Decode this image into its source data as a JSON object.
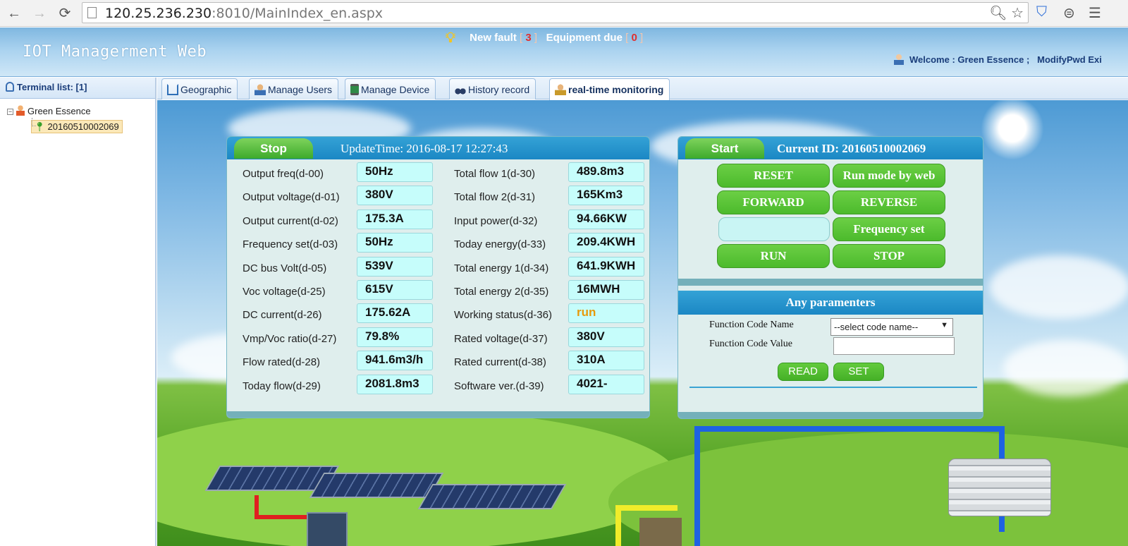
{
  "browser": {
    "url_host": "120.25.236.230",
    "url_rest": ":8010/MainIndex_en.aspx",
    "back_glyph": "←",
    "forward_glyph": "→",
    "reload_glyph": "⟳"
  },
  "header": {
    "title": "IOT Managerment Web",
    "fault_label": "New fault",
    "fault_count": "3",
    "equipment_label": "Equipment due",
    "equipment_count": "0",
    "welcome_text": "Welcome : Green Essence ;",
    "modify_pwd": "ModifyPwd",
    "exit": "Exi"
  },
  "sidebar": {
    "title": "Terminal list: [1]",
    "toggle": "⊟",
    "group": "Green Essence",
    "device": "20160510002069"
  },
  "tabs": [
    {
      "label": "Geographic",
      "icon": "house-icon"
    },
    {
      "label": "Manage Users",
      "icon": "user-icon"
    },
    {
      "label": "Manage Device",
      "icon": "device-icon"
    },
    {
      "label": "History record",
      "icon": "binoculars-icon"
    },
    {
      "label": "real-time monitoring",
      "icon": "user-icon"
    }
  ],
  "monitor": {
    "state_button": "Stop",
    "update_label": "UpdateTime:",
    "update_time": "2016-08-17 12:27:43",
    "left_rows": [
      {
        "label": "Output freq(d-00)",
        "value": "50Hz"
      },
      {
        "label": "Output voltage(d-01)",
        "value": "380V"
      },
      {
        "label": "Output current(d-02)",
        "value": "175.3A"
      },
      {
        "label": "Frequency set(d-03)",
        "value": "50Hz"
      },
      {
        "label": "DC bus Volt(d-05)",
        "value": "539V"
      },
      {
        "label": "Voc voltage(d-25)",
        "value": "615V"
      },
      {
        "label": "DC current(d-26)",
        "value": "175.62A"
      },
      {
        "label": "Vmp/Voc ratio(d-27)",
        "value": "79.8%"
      },
      {
        "label": "Flow rated(d-28)",
        "value": "941.6m3/h"
      },
      {
        "label": "Today flow(d-29)",
        "value": "2081.8m3"
      }
    ],
    "right_rows": [
      {
        "label": "Total flow 1(d-30)",
        "value": "489.8m3"
      },
      {
        "label": "Total flow 2(d-31)",
        "value": "165Km3"
      },
      {
        "label": "Input power(d-32)",
        "value": "94.66KW"
      },
      {
        "label": "Today energy(d-33)",
        "value": "209.4KWH"
      },
      {
        "label": "Total energy 1(d-34)",
        "value": "641.9KWH"
      },
      {
        "label": "Total energy 2(d-35)",
        "value": "16MWH"
      },
      {
        "label": "Working status(d-36)",
        "value": "run"
      },
      {
        "label": "Rated voltage(d-37)",
        "value": "380V"
      },
      {
        "label": "Rated current(d-38)",
        "value": "310A"
      },
      {
        "label": "Software ver.(d-39)",
        "value": "4021-"
      }
    ]
  },
  "control": {
    "start_button": "Start",
    "current_id_label": "Current ID:",
    "current_id": "20160510002069",
    "buttons": {
      "reset": "RESET",
      "run_mode": "Run mode by web",
      "forward": "FORWARD",
      "reverse": "REVERSE",
      "frequency_set": "Frequency set",
      "run": "RUN",
      "stop": "STOP"
    },
    "params_title": "Any paramenters",
    "code_name_label": "Function Code Name",
    "code_value_label": "Function Code Value",
    "select_value": "--select code name--",
    "read": "READ",
    "set": "SET"
  },
  "colors": {
    "accent_blue": "#1b87c4",
    "button_green": "#4cba2c",
    "value_box": "#c6fdfb",
    "status_run": "#e79a0a",
    "fault_count": "#e03030"
  }
}
